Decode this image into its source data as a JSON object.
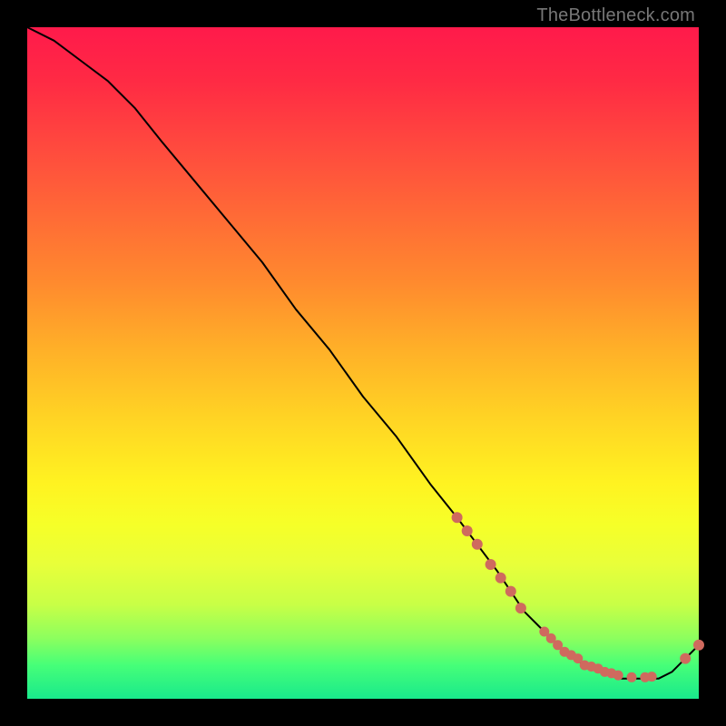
{
  "watermark": "TheBottleneck.com",
  "chart_data": {
    "type": "line",
    "title": "",
    "xlabel": "",
    "ylabel": "",
    "xlim": [
      0,
      100
    ],
    "ylim": [
      0,
      100
    ],
    "grid": false,
    "legend": false,
    "background": "rainbow-gradient",
    "series": [
      {
        "name": "curve",
        "x": [
          0,
          4,
          8,
          12,
          16,
          20,
          25,
          30,
          35,
          40,
          45,
          50,
          55,
          60,
          64,
          67,
          70,
          72,
          74,
          77,
          80,
          83,
          86,
          88,
          90,
          92,
          94,
          96,
          98,
          100
        ],
        "y": [
          100,
          98,
          95,
          92,
          88,
          83,
          77,
          71,
          65,
          58,
          52,
          45,
          39,
          32,
          27,
          23,
          19,
          16,
          13,
          10,
          7,
          5,
          4,
          3,
          3,
          3,
          3,
          4,
          6,
          8
        ]
      }
    ],
    "points": [
      {
        "name": "segment-upper",
        "x": [
          64,
          65.5,
          67,
          69,
          70.5,
          72,
          73.5
        ],
        "y": [
          27,
          25,
          23,
          20,
          18,
          16,
          13.5
        ]
      },
      {
        "name": "cluster-bottom",
        "x": [
          77,
          78,
          79,
          80,
          81,
          82,
          83,
          84,
          85,
          86,
          87,
          88,
          90,
          92,
          93
        ],
        "y": [
          10,
          9,
          8,
          7,
          6.5,
          6,
          5,
          4.8,
          4.5,
          4,
          3.8,
          3.5,
          3.2,
          3.2,
          3.3
        ]
      },
      {
        "name": "tail",
        "x": [
          98,
          100
        ],
        "y": [
          6,
          8
        ]
      }
    ]
  }
}
